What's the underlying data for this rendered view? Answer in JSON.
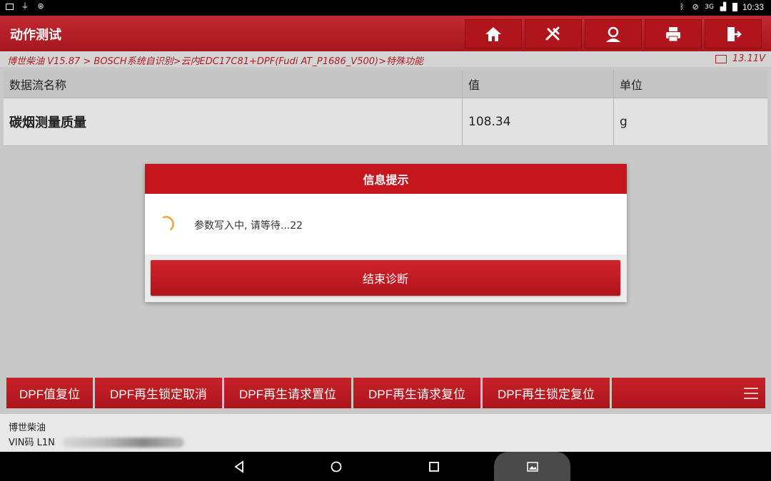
{
  "statusbar": {
    "left_icons": [
      "gallery-icon",
      "usb-icon",
      "debug-icon"
    ],
    "right_icons": [
      "bluetooth-icon",
      "no-disturb-icon",
      "signal-icon",
      "battery-icon"
    ],
    "network": "3G",
    "time": "10:33"
  },
  "header": {
    "title": "动作测试",
    "buttons": [
      "home-icon",
      "tools-icon",
      "user-icon",
      "print-icon",
      "exit-icon"
    ]
  },
  "breadcrumb": {
    "path": "博世柴油 V15.87 > BOSCH系统自识别>云内EDC17C81+DPF(Fudi AT_P1686_V500)>特殊功能",
    "voltage": "13.11V"
  },
  "table": {
    "headers": [
      "数据流名称",
      "值",
      "单位"
    ],
    "rows": [
      {
        "name": "碳烟测量质量",
        "value": "108.34",
        "unit": "g"
      }
    ]
  },
  "dialog": {
    "title": "信息提示",
    "message": "参数写入中, 请等待...22",
    "button": "结束诊断"
  },
  "function_buttons": [
    "DPF值复位",
    "DPF再生锁定取消",
    "DPF再生请求置位",
    "DPF再生请求复位",
    "DPF再生锁定复位"
  ],
  "info": {
    "brand": "博世柴油",
    "vin_label": "VIN码 L1N"
  },
  "colors": {
    "primary_red": "#c4161c",
    "breadcrumb_red": "#b21c25"
  }
}
